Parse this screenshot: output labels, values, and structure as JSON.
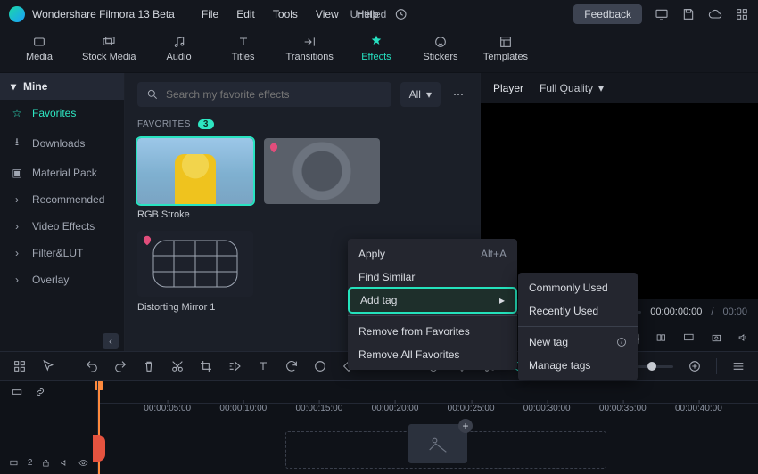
{
  "app": {
    "title": "Wondershare Filmora 13 Beta",
    "doc": "Untitled"
  },
  "menus": [
    "File",
    "Edit",
    "Tools",
    "View",
    "Help"
  ],
  "titlebar": {
    "feedback": "Feedback"
  },
  "tabs": [
    {
      "label": "Media"
    },
    {
      "label": "Stock Media"
    },
    {
      "label": "Audio"
    },
    {
      "label": "Titles"
    },
    {
      "label": "Transitions"
    },
    {
      "label": "Effects",
      "active": true
    },
    {
      "label": "Stickers"
    },
    {
      "label": "Templates"
    }
  ],
  "sidebar": {
    "header": "Mine",
    "items": [
      {
        "label": "Favorites",
        "active": true
      },
      {
        "label": "Downloads"
      },
      {
        "label": "Material Pack"
      },
      {
        "label": "Recommended"
      },
      {
        "label": "Video Effects"
      },
      {
        "label": "Filter&LUT"
      },
      {
        "label": "Overlay"
      }
    ]
  },
  "search": {
    "placeholder": "Search my favorite effects",
    "filter": "All"
  },
  "favorites": {
    "header": "FAVORITES",
    "count": "3",
    "items": [
      {
        "label": "RGB Stroke"
      },
      {
        "label": ""
      },
      {
        "label": "Distorting Mirror 1"
      }
    ]
  },
  "context_menu": {
    "apply": "Apply",
    "apply_shortcut": "Alt+A",
    "find_similar": "Find Similar",
    "add_tag": "Add tag",
    "remove_fav": "Remove from Favorites",
    "remove_all": "Remove All Favorites"
  },
  "tag_submenu": {
    "commonly": "Commonly Used",
    "recently": "Recently Used",
    "new": "New tag",
    "manage": "Manage tags"
  },
  "player": {
    "tab": "Player",
    "quality": "Full Quality",
    "time_current": "00:00:00:00",
    "time_total": "00:00"
  },
  "timeline": {
    "marks": [
      "00:00:05:00",
      "00:00:10:00",
      "00:00:15:00",
      "00:00:20:00",
      "00:00:25:00",
      "00:00:30:00",
      "00:00:35:00",
      "00:00:40:00"
    ],
    "track_badge": "2"
  }
}
